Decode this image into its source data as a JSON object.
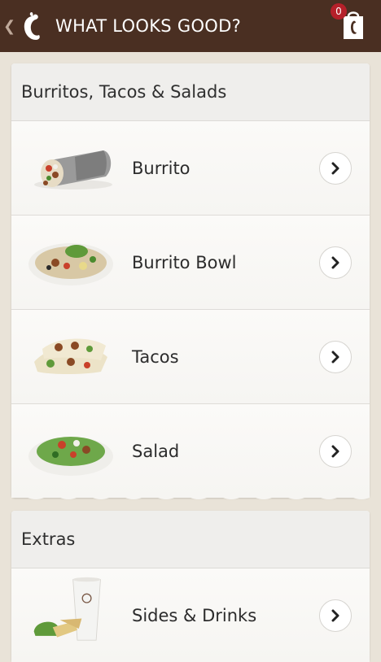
{
  "header": {
    "back_icon": "chevron-left-icon",
    "logo_icon": "chili-pepper-logo-icon",
    "title": "WHAT LOOKS GOOD?",
    "bag_icon": "shopping-bag-icon",
    "bag_count": "0",
    "colors": {
      "bar": "#4a2f22",
      "badge": "#b5202a"
    }
  },
  "sections": [
    {
      "title": "Burritos, Tacos & Salads",
      "items": [
        {
          "label": "Burrito",
          "image": "burrito-image"
        },
        {
          "label": "Burrito Bowl",
          "image": "burrito-bowl-image"
        },
        {
          "label": "Tacos",
          "image": "tacos-image"
        },
        {
          "label": "Salad",
          "image": "salad-image"
        }
      ]
    },
    {
      "title": "Extras",
      "items": [
        {
          "label": "Sides & Drinks",
          "image": "sides-drinks-image"
        }
      ]
    }
  ]
}
